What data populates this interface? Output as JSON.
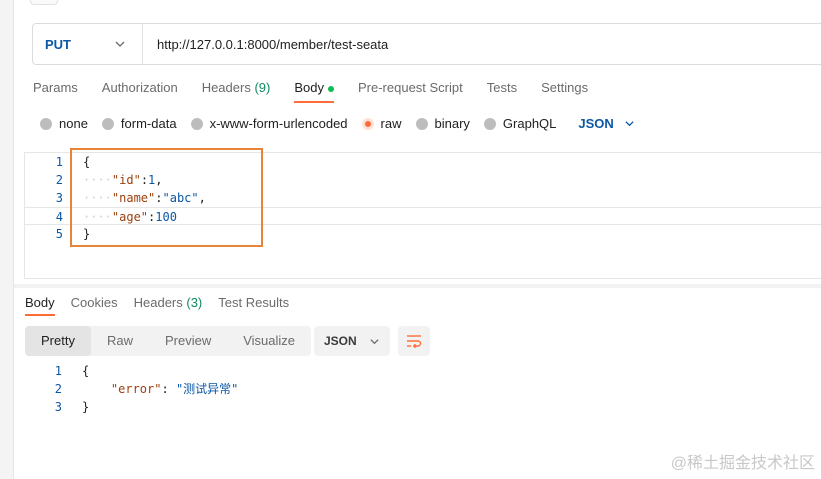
{
  "request": {
    "method": "PUT",
    "url": "http://127.0.0.1:8000/member/test-seata"
  },
  "request_tabs": [
    {
      "label": "Params"
    },
    {
      "label": "Authorization"
    },
    {
      "label": "Headers",
      "count": "(9)"
    },
    {
      "label": "Body",
      "active": true
    },
    {
      "label": "Pre-request Script"
    },
    {
      "label": "Tests"
    },
    {
      "label": "Settings"
    }
  ],
  "body_types": [
    {
      "label": "none"
    },
    {
      "label": "form-data"
    },
    {
      "label": "x-www-form-urlencoded"
    },
    {
      "label": "raw",
      "selected": true
    },
    {
      "label": "binary"
    },
    {
      "label": "GraphQL"
    }
  ],
  "body_format": "JSON",
  "request_body": {
    "line_numbers": [
      "1",
      "2",
      "3",
      "4",
      "5"
    ],
    "open_brace": "{",
    "close_brace": "}",
    "key_id": "\"id\"",
    "val_id": "1",
    "key_name": "\"name\"",
    "val_name": "\"abc\"",
    "key_age": "\"age\"",
    "val_age": "100"
  },
  "response_tabs": [
    {
      "label": "Body",
      "active": true
    },
    {
      "label": "Cookies"
    },
    {
      "label": "Headers",
      "count": "(3)"
    },
    {
      "label": "Test Results"
    }
  ],
  "view_modes": [
    {
      "label": "Pretty",
      "active": true
    },
    {
      "label": "Raw"
    },
    {
      "label": "Preview"
    },
    {
      "label": "Visualize"
    }
  ],
  "response_format": "JSON",
  "response_body": {
    "line_numbers": [
      "1",
      "2",
      "3"
    ],
    "open_brace": "{",
    "close_brace": "}",
    "key_error": "\"error\"",
    "val_error": "\"测试异常\""
  },
  "watermark": "@稀土掘金技术社区",
  "colors": {
    "accent": "#ff6c37",
    "method_blue": "#0b57a4",
    "highlight_box": "#e8843a",
    "status_green": "#0cbb52"
  }
}
